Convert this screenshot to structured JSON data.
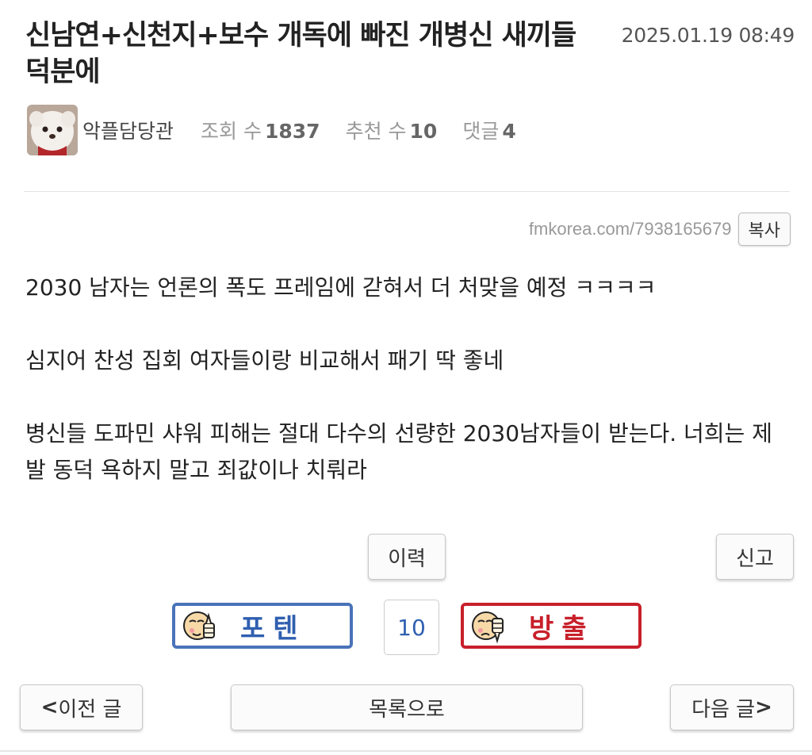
{
  "post": {
    "title": "신남연+신천지+보수 개독에 빠진 개병신 새끼들 덕분에",
    "date": "2025.01.19 08:49",
    "author": "악플담당관",
    "views_label": "조회 수",
    "views": "1837",
    "recommends_label": "추천 수",
    "recommends": "10",
    "comments_label": "댓글",
    "comments": "4",
    "url": "fmkorea.com/7938165679",
    "copy_label": "복사",
    "paragraphs": [
      "2030 남자는 언론의 폭도 프레임에 갇혀서 더 처맞을 예정 ㅋㅋㅋㅋ",
      "심지어 찬성 집회 여자들이랑 비교해서 패기 딱 좋네",
      "병신들 도파민 샤워 피해는 절대 다수의 선량한 2030남자들이 받는다. 너희는 제발 동덕 욕하지 말고 죄값이나 치뤄라"
    ]
  },
  "actions": {
    "history_label": "이력",
    "report_label": "신고",
    "upvote_label": "포텐",
    "downvote_label": "방출",
    "vote_count": "10"
  },
  "nav": {
    "prev_arrow": "<",
    "prev_label": "이전 글",
    "list_label": "목록으로",
    "next_label": "다음 글",
    "next_arrow": ">"
  },
  "colors": {
    "upvote": "#4a73b8",
    "downvote": "#c8202b"
  }
}
